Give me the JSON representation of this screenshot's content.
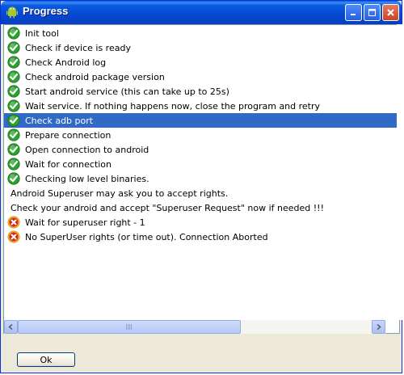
{
  "window": {
    "title": "Progress"
  },
  "log": {
    "selected_index": 6,
    "items": [
      {
        "status": "success",
        "text": "Init tool"
      },
      {
        "status": "success",
        "text": "Check if device is ready"
      },
      {
        "status": "success",
        "text": "Check Android log"
      },
      {
        "status": "success",
        "text": "Check android package version"
      },
      {
        "status": "success",
        "text": "Start android service (this can take up to 25s)"
      },
      {
        "status": "success",
        "text": "Wait service. If nothing happens now, close the program and retry"
      },
      {
        "status": "success",
        "text": "Check adb port"
      },
      {
        "status": "success",
        "text": "Prepare connection"
      },
      {
        "status": "success",
        "text": "Open connection to android"
      },
      {
        "status": "success",
        "text": "Wait for connection"
      },
      {
        "status": "success",
        "text": "Checking low level binaries."
      },
      {
        "status": "none",
        "text": "Android Superuser may ask you to accept rights."
      },
      {
        "status": "none",
        "text": "Check your android and accept \"Superuser Request\" now if needed !!!"
      },
      {
        "status": "error",
        "text": "Wait for superuser right  -  1"
      },
      {
        "status": "error",
        "text": "No SuperUser rights (or time out). Connection Aborted"
      }
    ]
  },
  "buttons": {
    "ok_label": "Ok"
  },
  "icons": {
    "success": "check-circle-icon",
    "error": "error-circle-icon",
    "app": "android-icon"
  },
  "colors": {
    "selection": "#316ac5",
    "success": "#2ea02e",
    "error": "#d8281c"
  }
}
